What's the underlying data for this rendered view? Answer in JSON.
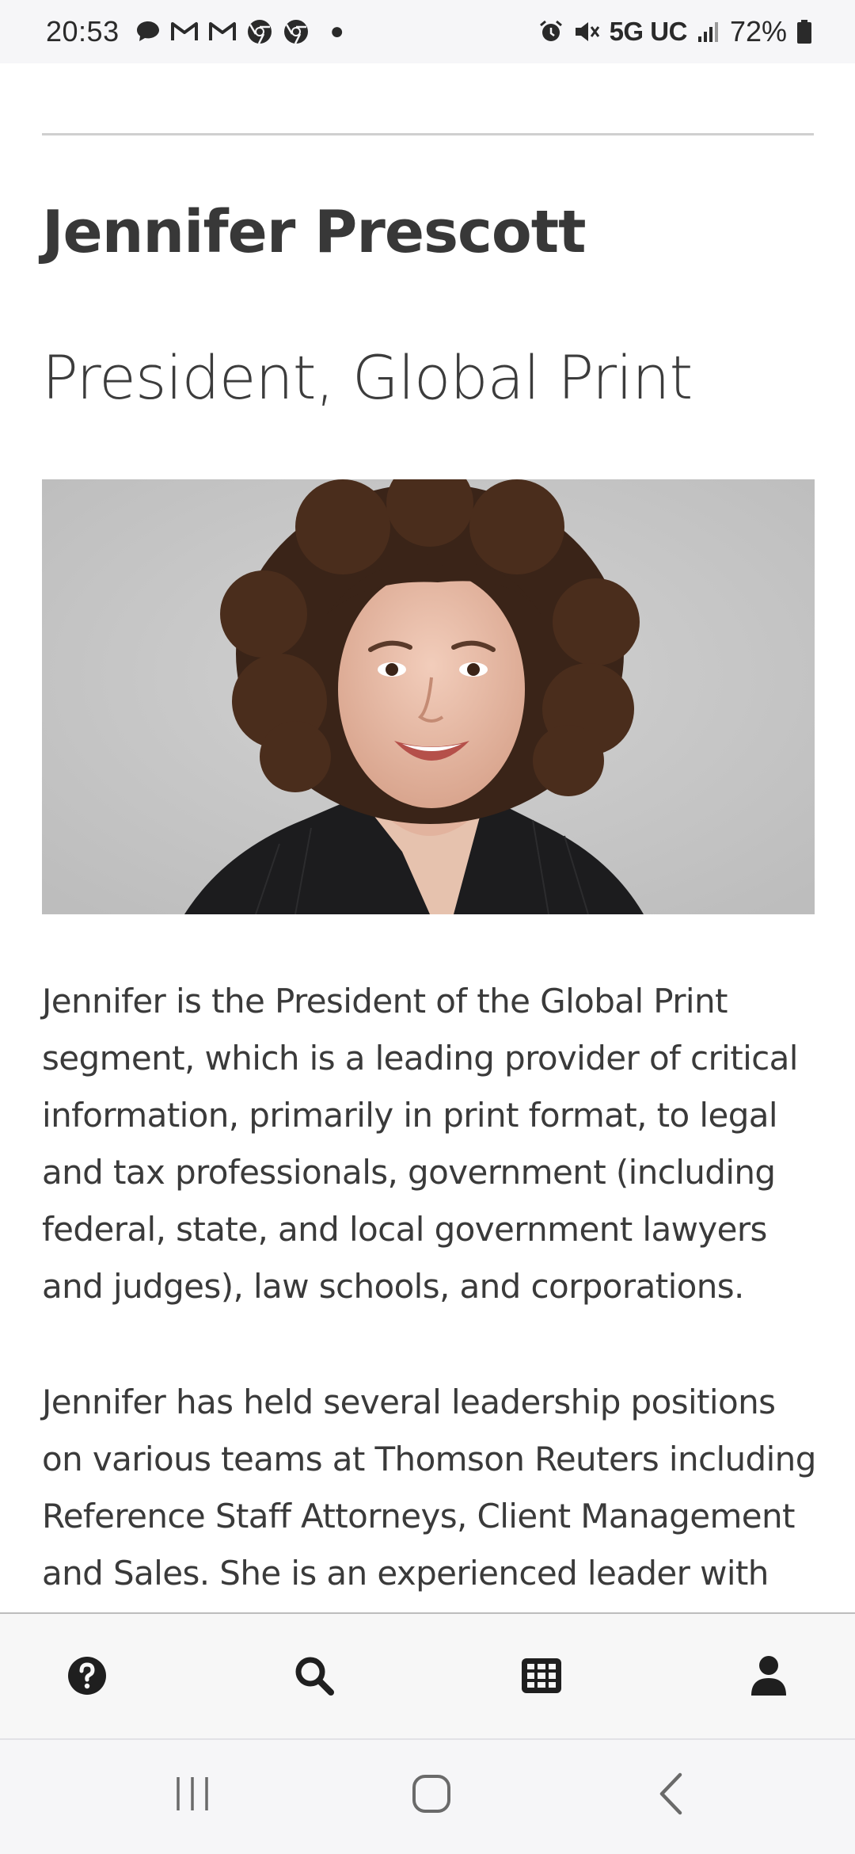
{
  "status_bar": {
    "time": "20:53",
    "left_icons": [
      "chat-bubble-icon",
      "gmail-icon",
      "gmail-icon",
      "chrome-icon",
      "chrome-icon",
      "notification-dot-icon"
    ],
    "network": "5G UC",
    "battery_percent": "72%",
    "right_icons": [
      "alarm-icon",
      "mute-icon",
      "signal-icon",
      "battery-icon"
    ]
  },
  "profile": {
    "name": "Jennifer Prescott",
    "title": "President, Global Print",
    "photo_background": "#c8c8c8"
  },
  "bio": [
    "Jennifer is the President of the Global Print segment, which is a leading provider of critical information, primarily in print format, to legal and tax professionals, government (including federal, state, and local government lawyers and judges), law schools, and corporations.",
    "Jennifer has held several leadership positions on various teams at Thomson Reuters including Reference Staff Attorneys, Client Management and Sales. She is an experienced leader with"
  ],
  "bottom_nav": {
    "items": [
      {
        "icon": "help-icon"
      },
      {
        "icon": "search-icon"
      },
      {
        "icon": "grid-icon"
      },
      {
        "icon": "account-icon"
      }
    ]
  },
  "system_nav": {
    "items": [
      "recents-icon",
      "home-icon",
      "back-icon"
    ]
  },
  "colors": {
    "text": "#333333",
    "divider": "#cfcfcf",
    "nav_background": "#f7f7f7",
    "icon": "#1f1f1f"
  }
}
